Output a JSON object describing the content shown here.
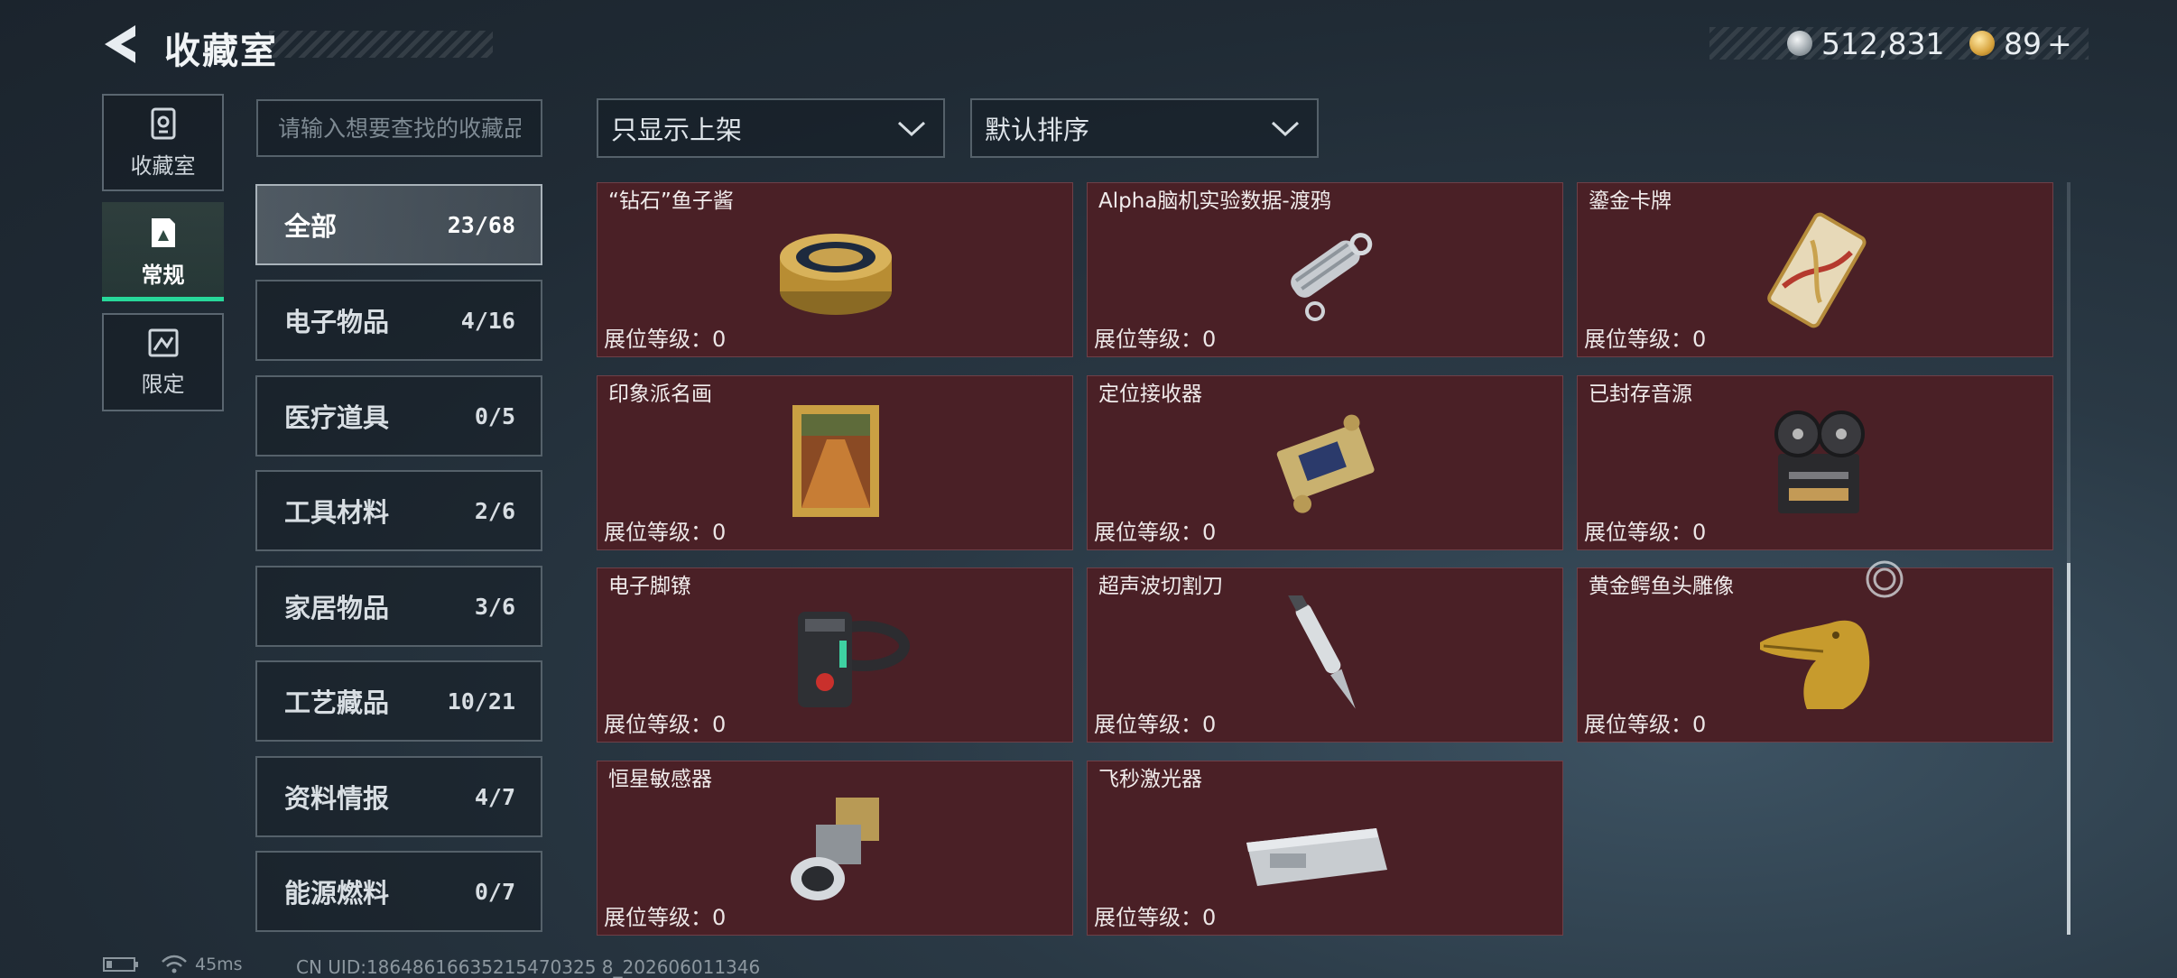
{
  "header": {
    "title": "收藏室",
    "currency": [
      {
        "icon": "silver-coin-icon",
        "value": "512,831"
      },
      {
        "icon": "gold-coin-icon",
        "value": "89"
      }
    ],
    "add_symbol": "+"
  },
  "side_tabs": [
    {
      "label": "收藏室",
      "icon": "collection-room-icon",
      "active": false
    },
    {
      "label": "常规",
      "icon": "regular-card-icon",
      "active": true
    },
    {
      "label": "限定",
      "icon": "limited-card-icon",
      "active": false
    }
  ],
  "search": {
    "placeholder": "请输入想要查找的收藏品",
    "value": ""
  },
  "filters": {
    "display": "只显示上架",
    "sort": "默认排序"
  },
  "subcategories": [
    {
      "name": "全部",
      "count": "23/68",
      "active": true
    },
    {
      "name": "电子物品",
      "count": "4/16"
    },
    {
      "name": "医疗道具",
      "count": "0/5"
    },
    {
      "name": "工具材料",
      "count": "2/6"
    },
    {
      "name": "家居物品",
      "count": "3/6"
    },
    {
      "name": "工艺藏品",
      "count": "10/21"
    },
    {
      "name": "资料情报",
      "count": "4/7"
    },
    {
      "name": "能源燃料",
      "count": "0/7"
    }
  ],
  "items": [
    {
      "name": "“钻石”鱼子酱",
      "level": "展位等级：0",
      "icon": "caviar-tin-icon"
    },
    {
      "name": "Alpha脑机实验数据-渡鸦",
      "level": "展位等级：0",
      "icon": "data-drive-icon"
    },
    {
      "name": "鎏金卡牌",
      "level": "展位等级：0",
      "icon": "gilded-card-icon"
    },
    {
      "name": "印象派名画",
      "level": "展位等级：0",
      "icon": "framed-painting-icon"
    },
    {
      "name": "定位接收器",
      "level": "展位等级：0",
      "icon": "locator-receiver-icon"
    },
    {
      "name": "已封存音源",
      "level": "展位等级：0",
      "icon": "reel-recorder-icon"
    },
    {
      "name": "电子脚镣",
      "level": "展位等级：0",
      "icon": "ankle-monitor-icon"
    },
    {
      "name": "超声波切割刀",
      "level": "展位等级：0",
      "icon": "ultrasonic-cutter-icon"
    },
    {
      "name": "黄金鳄鱼头雕像",
      "level": "展位等级：0",
      "icon": "golden-crocodile-statue-icon"
    },
    {
      "name": "恒星敏感器",
      "level": "展位等级：0",
      "icon": "star-sensor-icon"
    },
    {
      "name": "飞秒激光器",
      "level": "展位等级：0",
      "icon": "femtosecond-laser-icon"
    }
  ],
  "status_bar": {
    "latency": "45ms",
    "uid": "CN UID:18648616635215470325 8_202606011346"
  },
  "colors": {
    "card_bg": "#4a2026",
    "accent_green": "#27d89a"
  }
}
